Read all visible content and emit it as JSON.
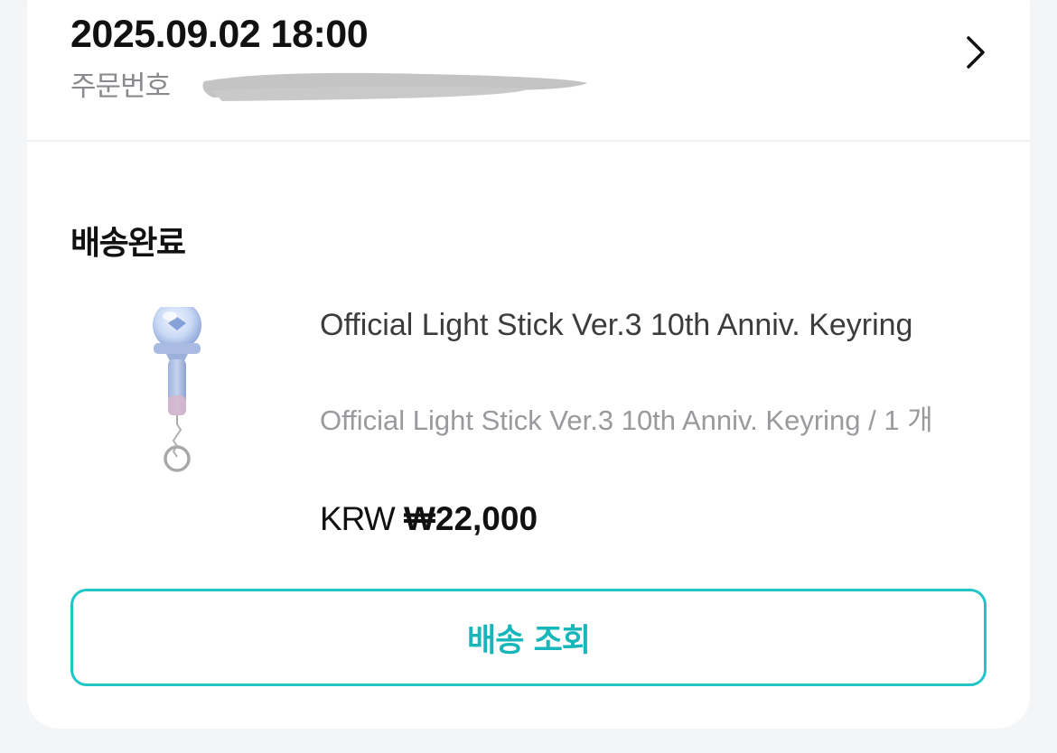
{
  "order": {
    "date": "2025.09.02 18:00",
    "number_label": "주문번호"
  },
  "status": {
    "title": "배송완료"
  },
  "product": {
    "name": "Official Light Stick Ver.3 10th Anniv. Keyring",
    "option": "Official Light Stick Ver.3 10th Anniv. Keyring / 1 개",
    "currency": "KRW",
    "price": "₩22,000"
  },
  "actions": {
    "track_label": "배송 조회"
  },
  "icons": {
    "chevron": "chevron-right-icon"
  },
  "colors": {
    "accent": "#21c5c8",
    "accent_text": "#17b6ba"
  }
}
